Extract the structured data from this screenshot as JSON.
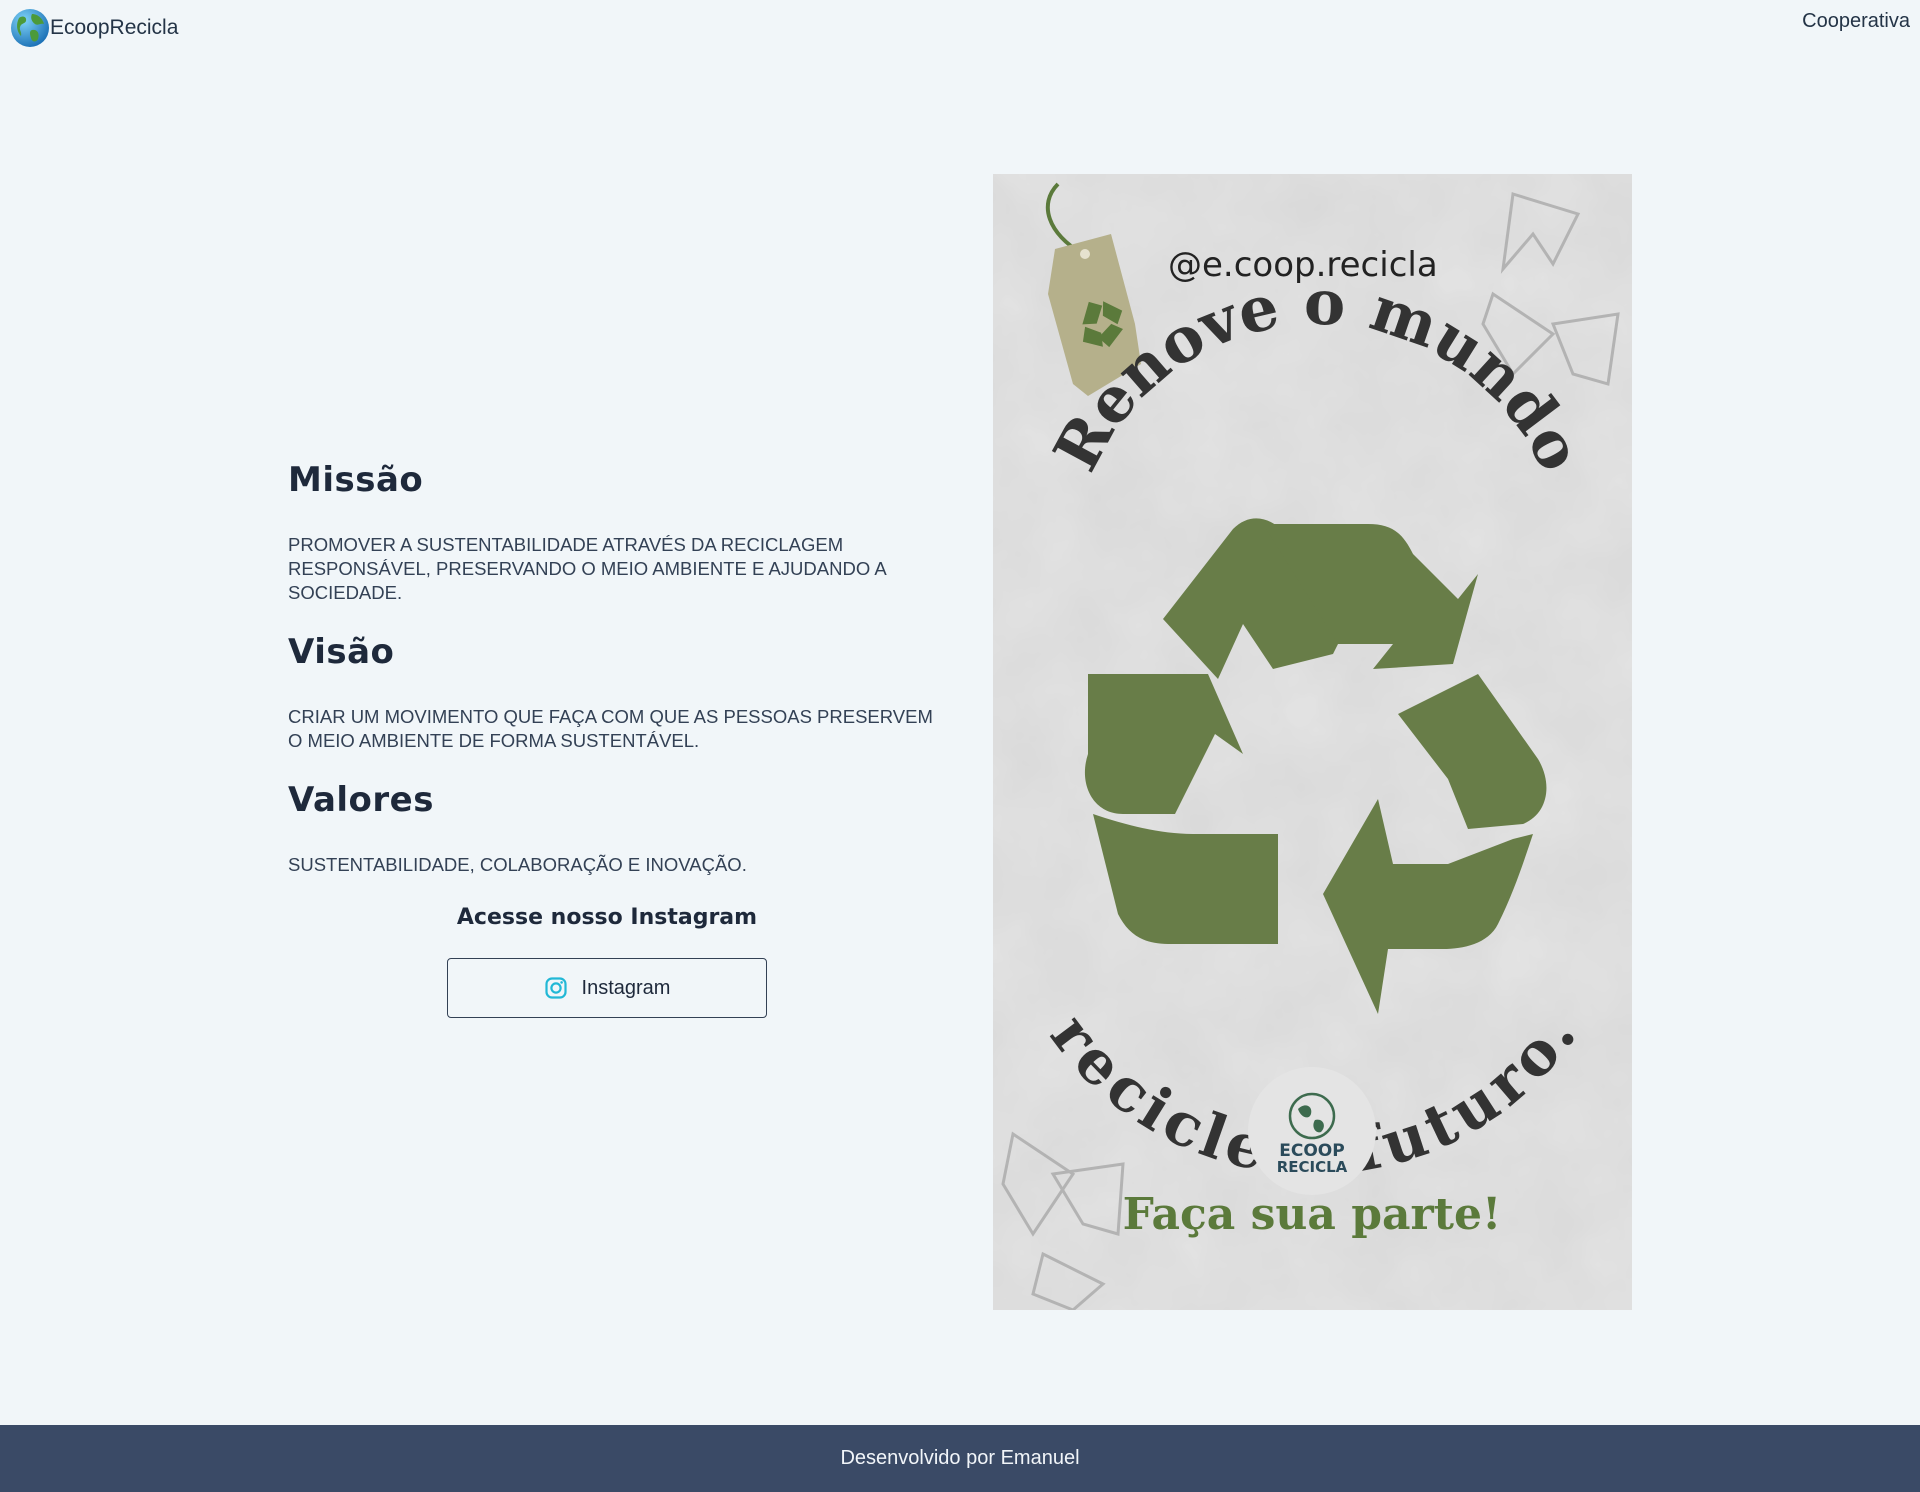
{
  "header": {
    "brand": "EcoopRecicla",
    "nav_link": "Cooperativa"
  },
  "sections": {
    "missao": {
      "title": "Missão",
      "text": "PROMOVER A SUSTENTABILIDADE ATRAVÉS DA RECICLAGEM RESPONSÁVEL, PRESERVANDO O MEIO AMBIENTE E AJUDANDO A SOCIEDADE."
    },
    "visao": {
      "title": "Visão",
      "text": "CRIAR UM MOVIMENTO QUE FAÇA COM QUE AS PESSOAS PRESERVEM O MEIO AMBIENTE DE FORMA SUSTENTÁVEL."
    },
    "valores": {
      "title": "Valores",
      "text": "SUSTENTABILIDADE, COLABORAÇÃO E INOVAÇÃO."
    }
  },
  "instagram": {
    "title": "Acesse nosso Instagram",
    "button_label": "Instagram"
  },
  "poster": {
    "handle": "@e.coop.recicla",
    "arc_top": "Renove o mundo",
    "arc_bottom": "recicle o futuro.",
    "logo_line1": "ECOOP",
    "logo_line2": "RECICLA",
    "call_to_action": "Faça sua parte!"
  },
  "footer": {
    "text": "Desenvolvido por Emanuel"
  },
  "colors": {
    "background": "#f1f6f9",
    "text": "#1e293b",
    "footer": "#3a4a66",
    "recycle_green": "#687d48",
    "instagram_icon": "#22b8d6"
  },
  "icons": {
    "brand": "globe-icon",
    "instagram": "instagram-icon",
    "poster_main": "recycle-icon"
  }
}
